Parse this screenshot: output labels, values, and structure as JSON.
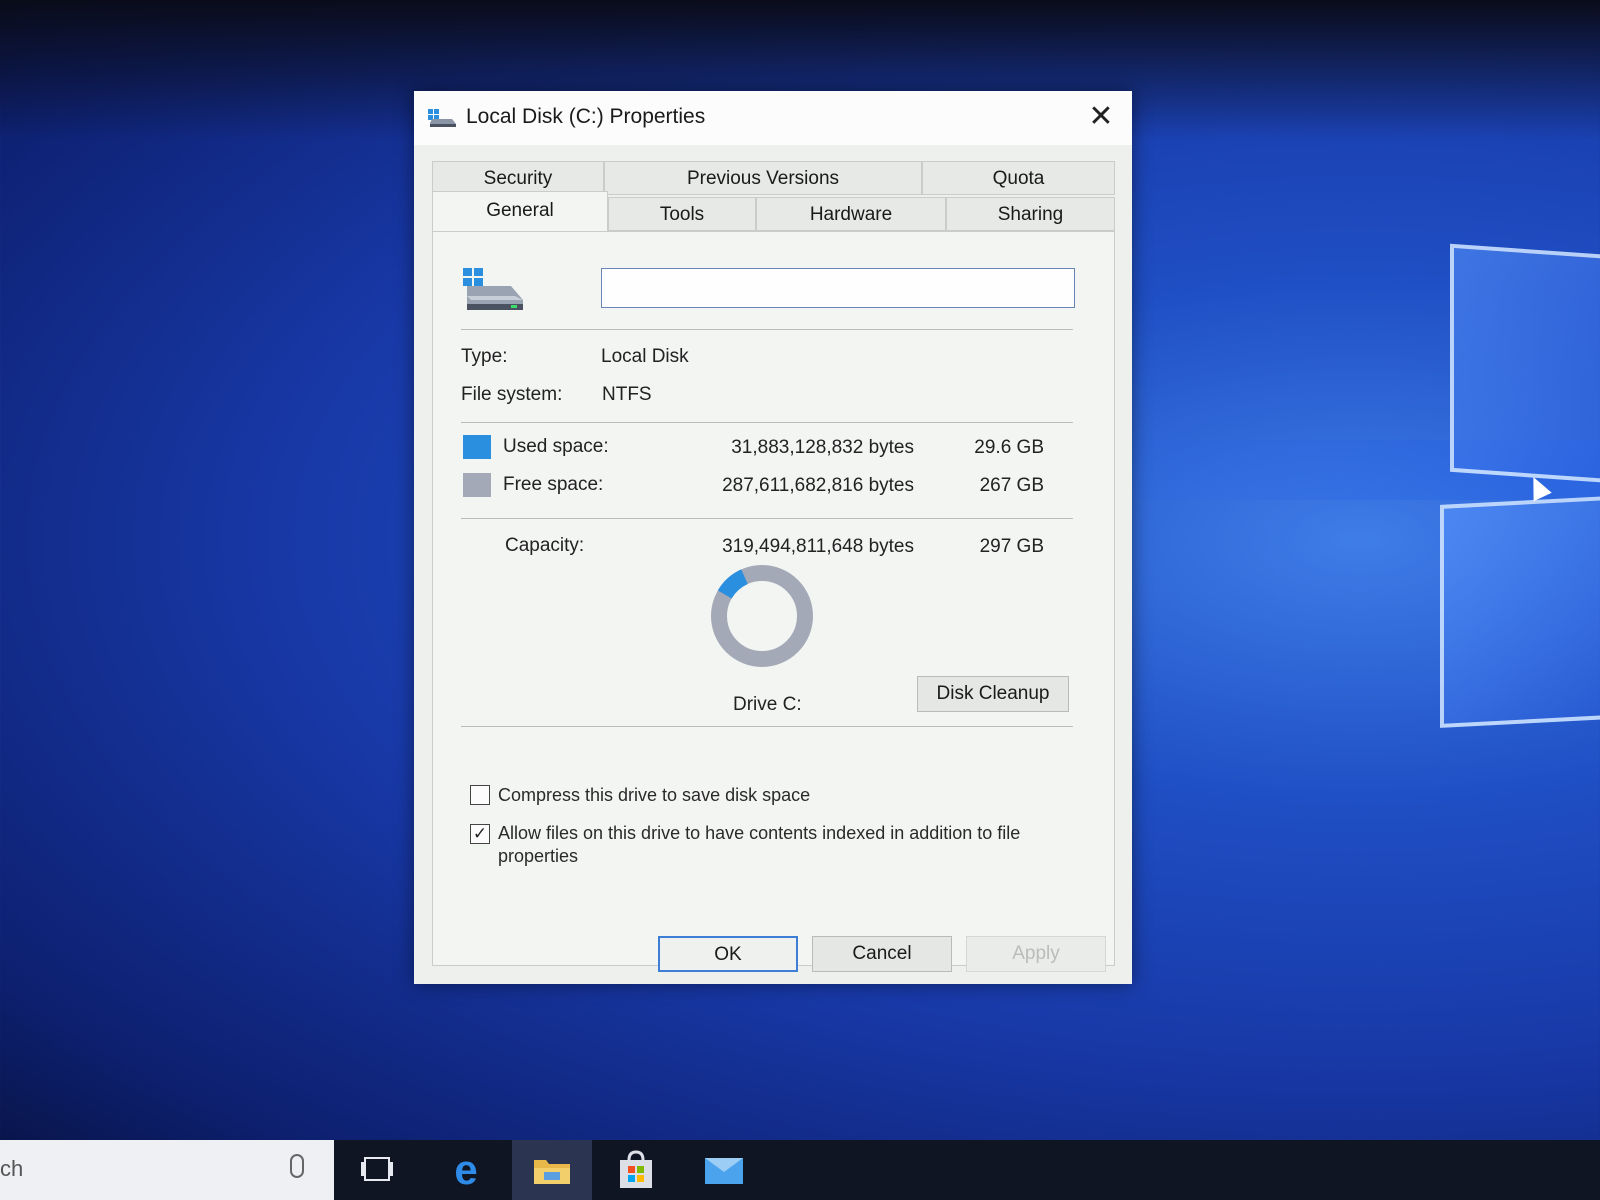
{
  "dialog": {
    "title": "Local Disk (C:) Properties",
    "close_glyph": "✕"
  },
  "tabs": {
    "row1": [
      {
        "label": "Security",
        "name": "tab-security"
      },
      {
        "label": "Previous Versions",
        "name": "tab-previous-versions"
      },
      {
        "label": "Quota",
        "name": "tab-quota"
      }
    ],
    "row2": [
      {
        "label": "General",
        "name": "tab-general",
        "active": true
      },
      {
        "label": "Tools",
        "name": "tab-tools"
      },
      {
        "label": "Hardware",
        "name": "tab-hardware"
      },
      {
        "label": "Sharing",
        "name": "tab-sharing"
      }
    ]
  },
  "general": {
    "volume_label_value": "",
    "type_label": "Type:",
    "type_value": "Local Disk",
    "fs_label": "File system:",
    "fs_value": "NTFS",
    "used_label": "Used space:",
    "used_bytes": "31,883,128,832 bytes",
    "used_gb": "29.6 GB",
    "free_label": "Free space:",
    "free_bytes": "287,611,682,816 bytes",
    "free_gb": "267 GB",
    "capacity_label": "Capacity:",
    "capacity_bytes": "319,494,811,648 bytes",
    "capacity_gb": "297 GB",
    "drive_caption": "Drive C:",
    "disk_cleanup": "Disk Cleanup",
    "used_fraction": 0.0998,
    "compress_label": "Compress this drive to save disk space",
    "compress_checked": false,
    "index_label": "Allow files on this drive to have contents indexed in addition to file properties",
    "index_checked": true
  },
  "buttons": {
    "ok": "OK",
    "cancel": "Cancel",
    "apply": "Apply"
  },
  "colors": {
    "used": "#2b8fe0",
    "free": "#a3a9b6",
    "accent": "#3d7fd6"
  },
  "taskbar": {
    "search_text": "ch",
    "icons": [
      "microphone-icon",
      "task-view-icon",
      "edge-icon",
      "file-explorer-icon",
      "store-icon",
      "mail-icon"
    ]
  }
}
